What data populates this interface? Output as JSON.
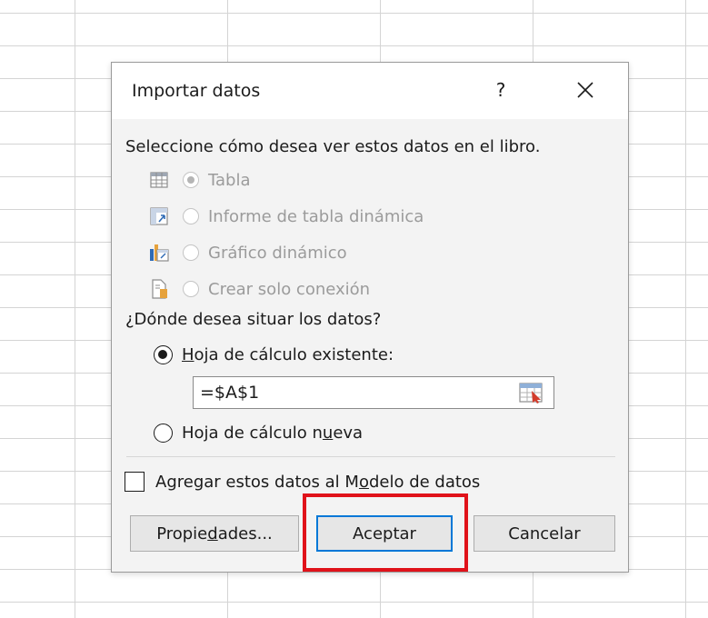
{
  "dialog": {
    "title": "Importar datos",
    "help": "?",
    "prompt": "Seleccione cómo desea ver estos datos en el libro.",
    "view_options": [
      {
        "label": "Tabla",
        "checked": true,
        "enabled": false,
        "icon": "table-icon"
      },
      {
        "label": "Informe de tabla dinámica",
        "checked": false,
        "enabled": false,
        "icon": "pivot-table-icon"
      },
      {
        "label": "Gráfico dinámico",
        "checked": false,
        "enabled": false,
        "icon": "pivot-chart-icon"
      },
      {
        "label": "Crear solo conexión",
        "checked": false,
        "enabled": false,
        "icon": "connection-icon"
      }
    ],
    "where_prompt": "¿Dónde desea situar los datos?",
    "destination": {
      "existing_sheet": {
        "label_pre": "",
        "label_accel": "H",
        "label_post": "oja de cálculo existente:",
        "checked": true
      },
      "reference_value": "=$A$1",
      "new_sheet": {
        "label_pre": "Hoja de cálculo n",
        "label_accel": "u",
        "label_post": "eva",
        "checked": false
      }
    },
    "data_model": {
      "label_pre": "Agregar estos datos al M",
      "label_accel": "o",
      "label_post": "delo de datos",
      "checked": false
    },
    "buttons": {
      "properties": {
        "pre": "Propie",
        "accel": "d",
        "post": "ades..."
      },
      "accept": "Aceptar",
      "cancel": "Cancelar"
    },
    "highlight_color": "#e0121a",
    "accent_color": "#0078d7"
  }
}
